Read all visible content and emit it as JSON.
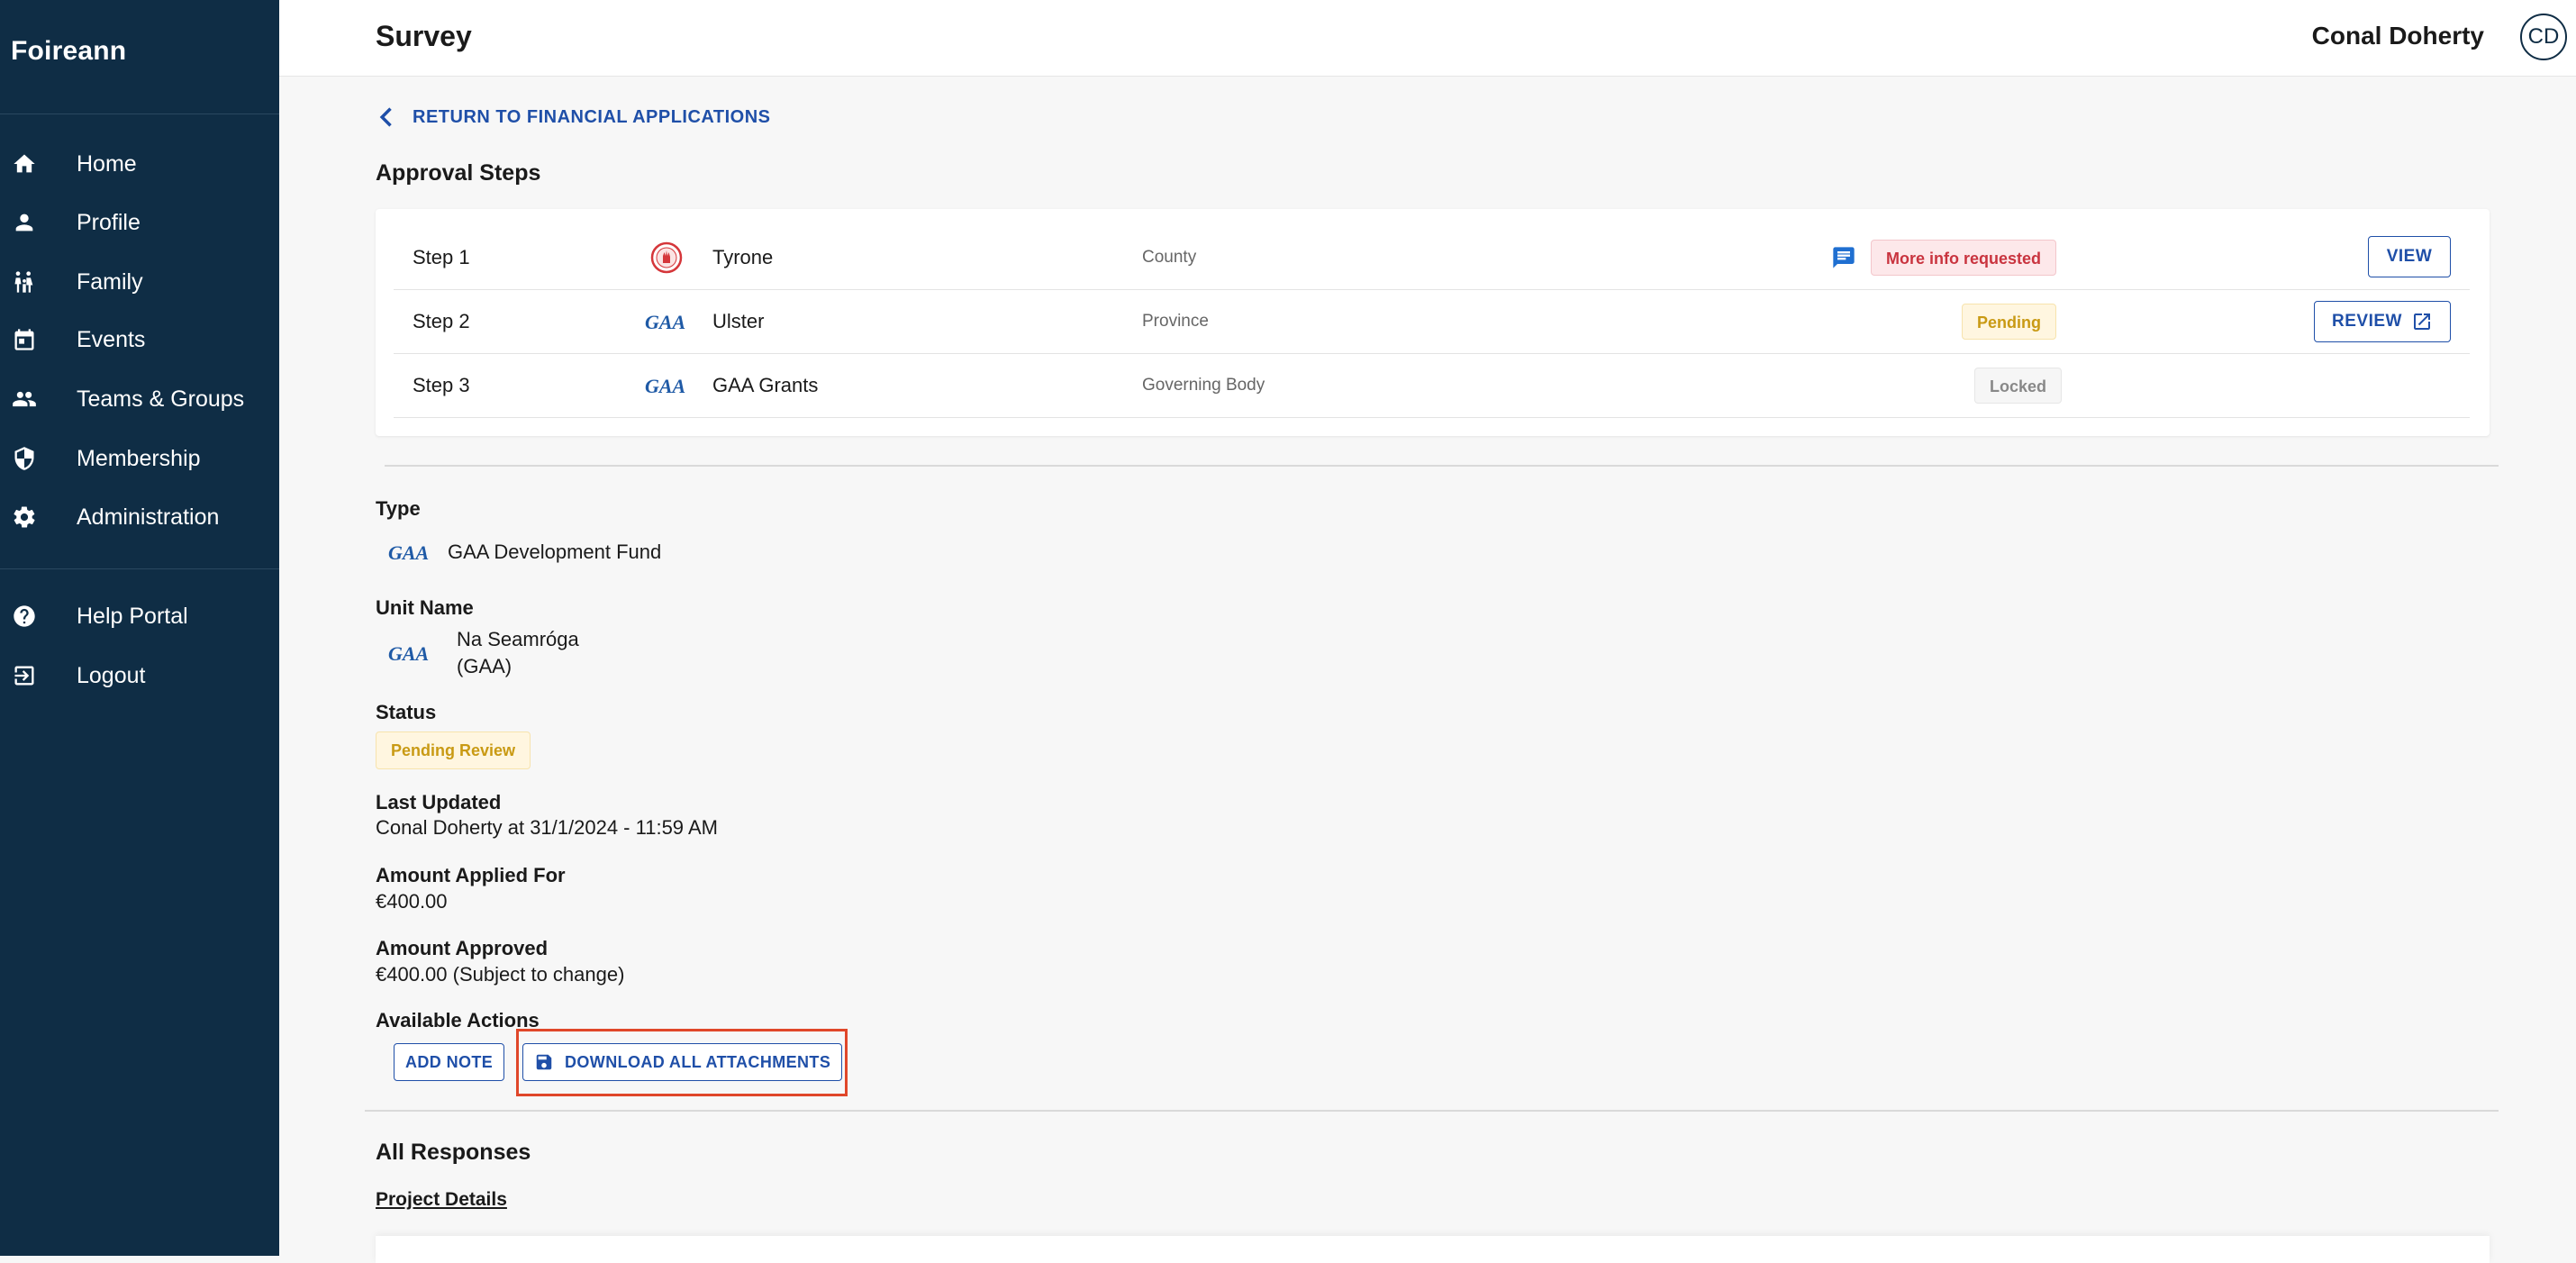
{
  "sidebar": {
    "brand": "Foireann",
    "items": [
      {
        "label": "Home"
      },
      {
        "label": "Profile"
      },
      {
        "label": "Family"
      },
      {
        "label": "Events"
      },
      {
        "label": "Teams & Groups"
      },
      {
        "label": "Membership"
      },
      {
        "label": "Administration"
      }
    ],
    "secondary": [
      {
        "label": "Help Portal"
      },
      {
        "label": "Logout"
      }
    ]
  },
  "header": {
    "title": "Survey",
    "user_name": "Conal Doherty",
    "user_initials": "CD"
  },
  "back_link": "RETURN TO FINANCIAL APPLICATIONS",
  "approval": {
    "title": "Approval Steps",
    "steps": [
      {
        "step": "Step 1",
        "name": "Tyrone",
        "level": "County",
        "status": "More info requested",
        "action": "VIEW"
      },
      {
        "step": "Step 2",
        "name": "Ulster",
        "level": "Province",
        "status": "Pending",
        "action": "REVIEW"
      },
      {
        "step": "Step 3",
        "name": "GAA Grants",
        "level": "Governing Body",
        "status": "Locked",
        "action": ""
      }
    ]
  },
  "details": {
    "type_label": "Type",
    "type_value": "GAA Development Fund",
    "unit_label": "Unit Name",
    "unit_value_line1": "Na Seamróga",
    "unit_value_line2": "(GAA)",
    "status_label": "Status",
    "status_value": "Pending Review",
    "last_updated_label": "Last Updated",
    "last_updated_value": "Conal Doherty at 31/1/2024 - 11:59 AM",
    "amount_applied_label": "Amount Applied For",
    "amount_applied_value": "€400.00",
    "amount_approved_label": "Amount Approved",
    "amount_approved_value": "€400.00 (Subject to change)",
    "actions_label": "Available Actions",
    "add_note": "ADD NOTE",
    "download_all": "DOWNLOAD ALL ATTACHMENTS"
  },
  "responses": {
    "title": "All Responses",
    "subheading": "Project Details"
  },
  "colors": {
    "sidebar_bg": "#0f2d45",
    "accent": "#1f4fa8",
    "highlight": "#e0472a"
  }
}
